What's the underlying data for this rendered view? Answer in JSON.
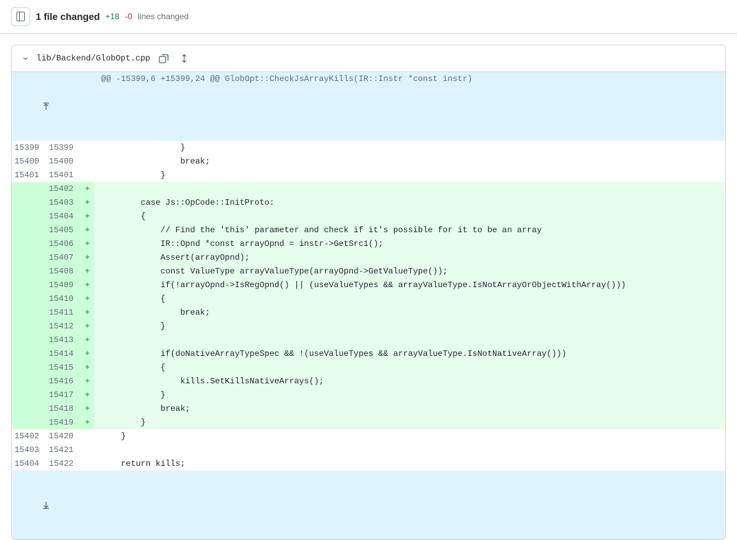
{
  "summary": {
    "files_changed": "1 file changed",
    "additions": "+18",
    "deletions": "-0",
    "lines_changed_label": "lines changed"
  },
  "file": {
    "path": "lib/Backend/GlobOpt.cpp",
    "hunk_header": "@@ -15399,6 +15399,24 @@ GlobOpt::CheckJsArrayKills(IR::Instr *const instr)",
    "lines": [
      {
        "old": "15399",
        "new": "15399",
        "type": "ctx",
        "marker": "",
        "text": "                }"
      },
      {
        "old": "15400",
        "new": "15400",
        "type": "ctx",
        "marker": "",
        "text": "                break;"
      },
      {
        "old": "15401",
        "new": "15401",
        "type": "ctx",
        "marker": "",
        "text": "            }"
      },
      {
        "old": "",
        "new": "15402",
        "type": "add",
        "marker": "+",
        "text": ""
      },
      {
        "old": "",
        "new": "15403",
        "type": "add",
        "marker": "+",
        "text": "        case Js::OpCode::InitProto:"
      },
      {
        "old": "",
        "new": "15404",
        "type": "add",
        "marker": "+",
        "text": "        {"
      },
      {
        "old": "",
        "new": "15405",
        "type": "add",
        "marker": "+",
        "text": "            // Find the 'this' parameter and check if it's possible for it to be an array"
      },
      {
        "old": "",
        "new": "15406",
        "type": "add",
        "marker": "+",
        "text": "            IR::Opnd *const arrayOpnd = instr->GetSrc1();"
      },
      {
        "old": "",
        "new": "15407",
        "type": "add",
        "marker": "+",
        "text": "            Assert(arrayOpnd);"
      },
      {
        "old": "",
        "new": "15408",
        "type": "add",
        "marker": "+",
        "text": "            const ValueType arrayValueType(arrayOpnd->GetValueType());"
      },
      {
        "old": "",
        "new": "15409",
        "type": "add",
        "marker": "+",
        "text": "            if(!arrayOpnd->IsRegOpnd() || (useValueTypes && arrayValueType.IsNotArrayOrObjectWithArray()))"
      },
      {
        "old": "",
        "new": "15410",
        "type": "add",
        "marker": "+",
        "text": "            {"
      },
      {
        "old": "",
        "new": "15411",
        "type": "add",
        "marker": "+",
        "text": "                break;"
      },
      {
        "old": "",
        "new": "15412",
        "type": "add",
        "marker": "+",
        "text": "            }"
      },
      {
        "old": "",
        "new": "15413",
        "type": "add",
        "marker": "+",
        "text": ""
      },
      {
        "old": "",
        "new": "15414",
        "type": "add",
        "marker": "+",
        "text": "            if(doNativeArrayTypeSpec && !(useValueTypes && arrayValueType.IsNotNativeArray()))"
      },
      {
        "old": "",
        "new": "15415",
        "type": "add",
        "marker": "+",
        "text": "            {"
      },
      {
        "old": "",
        "new": "15416",
        "type": "add",
        "marker": "+",
        "text": "                kills.SetKillsNativeArrays();"
      },
      {
        "old": "",
        "new": "15417",
        "type": "add",
        "marker": "+",
        "text": "            }"
      },
      {
        "old": "",
        "new": "15418",
        "type": "add",
        "marker": "+",
        "text": "            break;"
      },
      {
        "old": "",
        "new": "15419",
        "type": "add",
        "marker": "+",
        "text": "        }"
      },
      {
        "old": "15402",
        "new": "15420",
        "type": "ctx",
        "marker": "",
        "text": "    }"
      },
      {
        "old": "15403",
        "new": "15421",
        "type": "ctx",
        "marker": "",
        "text": ""
      },
      {
        "old": "15404",
        "new": "15422",
        "type": "ctx",
        "marker": "",
        "text": "    return kills;"
      }
    ]
  }
}
